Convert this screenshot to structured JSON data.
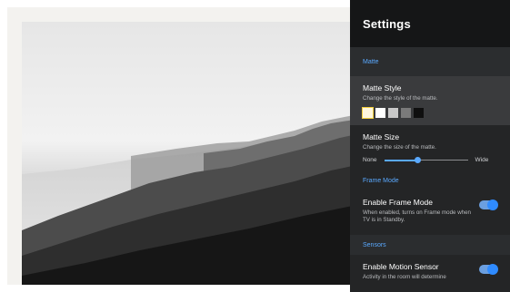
{
  "settings": {
    "title": "Settings",
    "sections": {
      "matte": "Matte",
      "frame_mode": "Frame Mode",
      "sensors": "Sensors"
    },
    "matte_style": {
      "title": "Matte Style",
      "description": "Change the style of the matte.",
      "swatches": [
        "#fff6dc",
        "#ffffff",
        "#c8c8c8",
        "#7a7a7a",
        "#0f0f0f"
      ],
      "selected_index": 0
    },
    "matte_size": {
      "title": "Matte Size",
      "description": "Change the size of the matte.",
      "min_label": "None",
      "max_label": "Wide",
      "value": 0.4
    },
    "enable_frame_mode": {
      "title": "Enable Frame Mode",
      "description": "When enabled, turns on Frame mode when TV is in Standby.",
      "enabled": true
    },
    "enable_motion_sensor": {
      "title": "Enable Motion Sensor",
      "description": "Activity in the room will determine",
      "enabled": true
    }
  },
  "colors": {
    "accent": "#5aa9ff",
    "panel": "#242526",
    "header": "#151617"
  }
}
